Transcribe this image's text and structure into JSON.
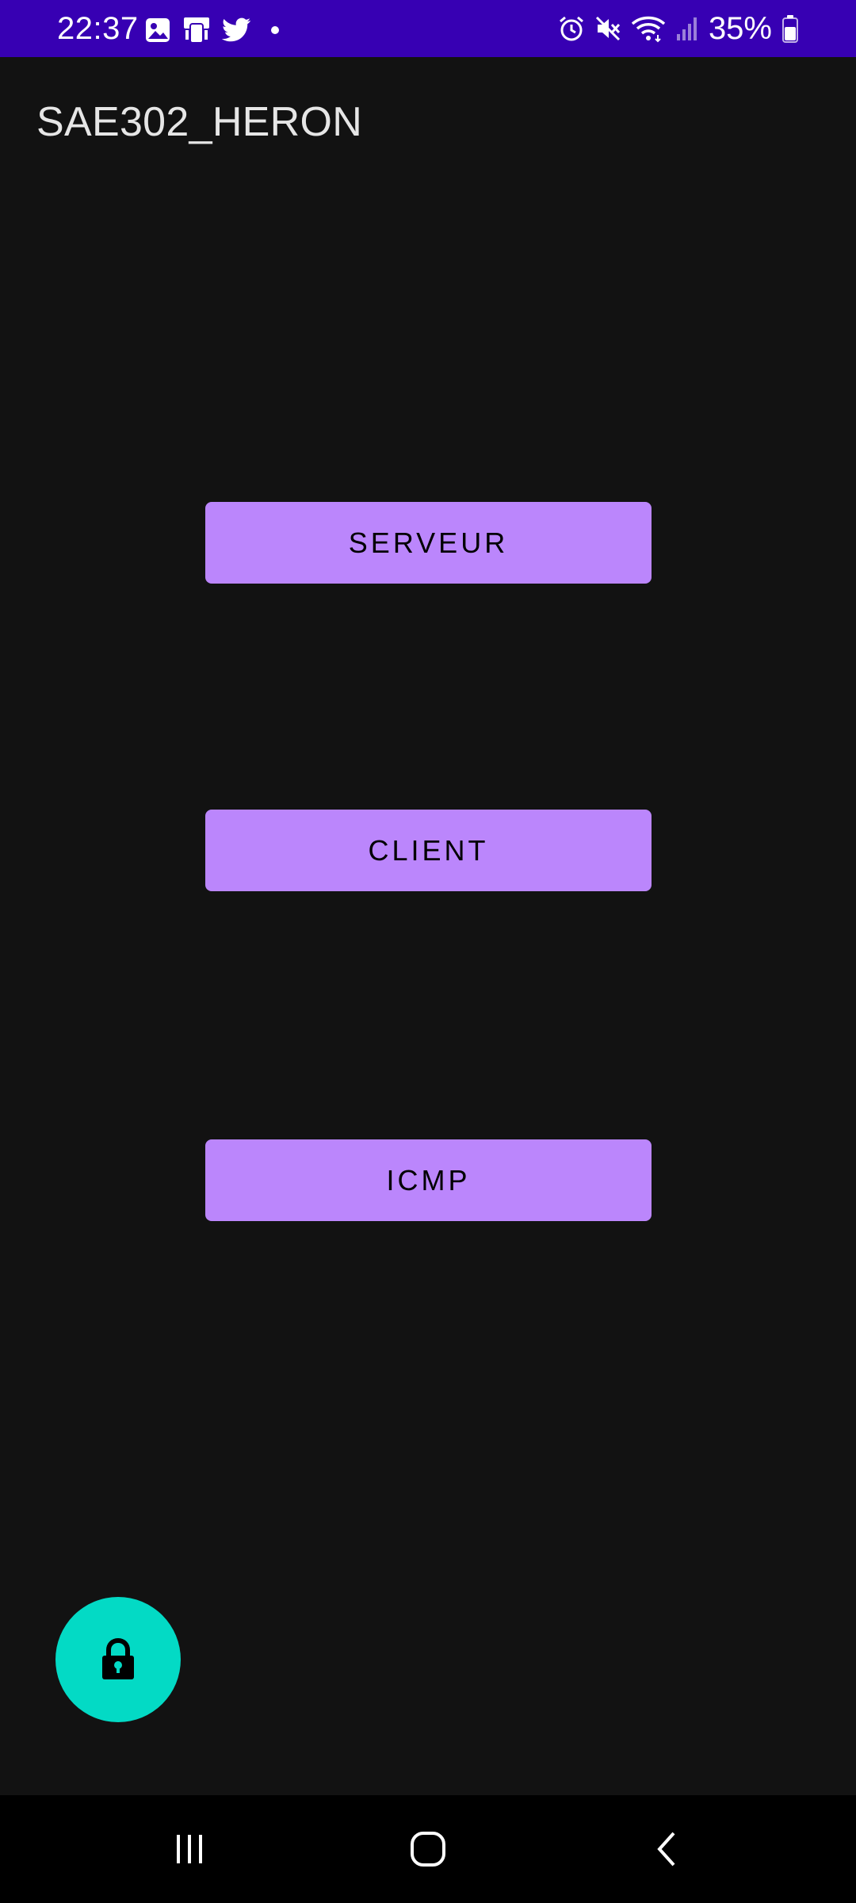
{
  "status_bar": {
    "time": "22:37",
    "battery": "35%",
    "background_color": "#3700b3",
    "left_icons": [
      "gallery-icon",
      "device-icon",
      "twitter-icon",
      "dot-icon"
    ],
    "right_icons": [
      "alarm-icon",
      "mute-icon",
      "wifi-icon",
      "signal-icon",
      "battery-icon"
    ]
  },
  "app_bar": {
    "title": "SAE302_HERON"
  },
  "main": {
    "buttons": [
      {
        "label": "SERVEUR"
      },
      {
        "label": "CLIENT"
      },
      {
        "label": "ICMP"
      }
    ],
    "button_color": "#bb86fc"
  },
  "fab": {
    "icon": "lock-icon",
    "color": "#03dac5"
  },
  "nav_bar": {
    "items": [
      "recents-icon",
      "home-icon",
      "back-icon"
    ]
  }
}
